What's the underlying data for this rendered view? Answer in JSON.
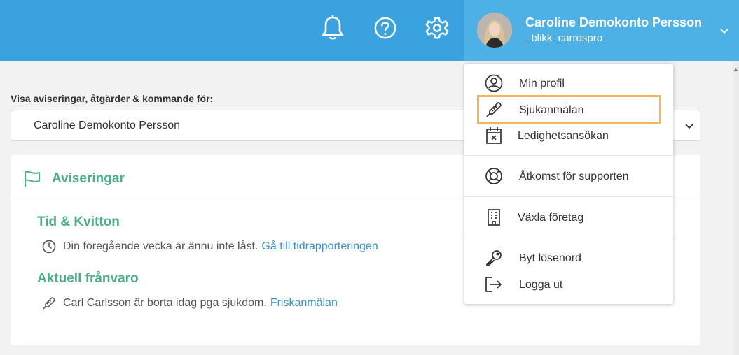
{
  "header": {
    "user_name": "Caroline Demokonto Persson",
    "user_sub": "_blikk_carrospro",
    "icons": [
      "bell-icon",
      "help-icon",
      "gear-icon",
      "chevron-down-icon"
    ]
  },
  "filter": {
    "label": "Visa aviseringar, åtgärder & kommande för:",
    "selected": "Caroline Demokonto Persson"
  },
  "card": {
    "title": "Aviseringar",
    "sections": [
      {
        "title": "Tid & Kvitton",
        "text": "Din föregående vecka är ännu inte låst.",
        "link": "Gå till tidrapporteringen",
        "icon": "clock-icon"
      },
      {
        "title": "Aktuell frånvaro",
        "text": "Carl Carlsson är borta idag pga sjukdom.",
        "link": "Friskanmälan",
        "icon": "thermometer-icon"
      }
    ]
  },
  "menu": {
    "items": [
      {
        "label": "Min profil",
        "icon": "user-circle-icon"
      },
      {
        "label": "Sjukanmälan",
        "icon": "thermometer-icon"
      },
      {
        "label": "Ledighetsansökan",
        "icon": "calendar-x-icon"
      },
      {
        "label": "Åtkomst för supporten",
        "icon": "lifebuoy-icon"
      },
      {
        "label": "Växla företag",
        "icon": "building-icon"
      },
      {
        "label": "Byt lösenord",
        "icon": "key-icon"
      },
      {
        "label": "Logga ut",
        "icon": "logout-icon"
      }
    ],
    "highlight_color": "#f5b75a"
  },
  "colors": {
    "topbar": "#3aa3df",
    "accent_green": "#4caf8a",
    "link": "#3a90d2"
  }
}
